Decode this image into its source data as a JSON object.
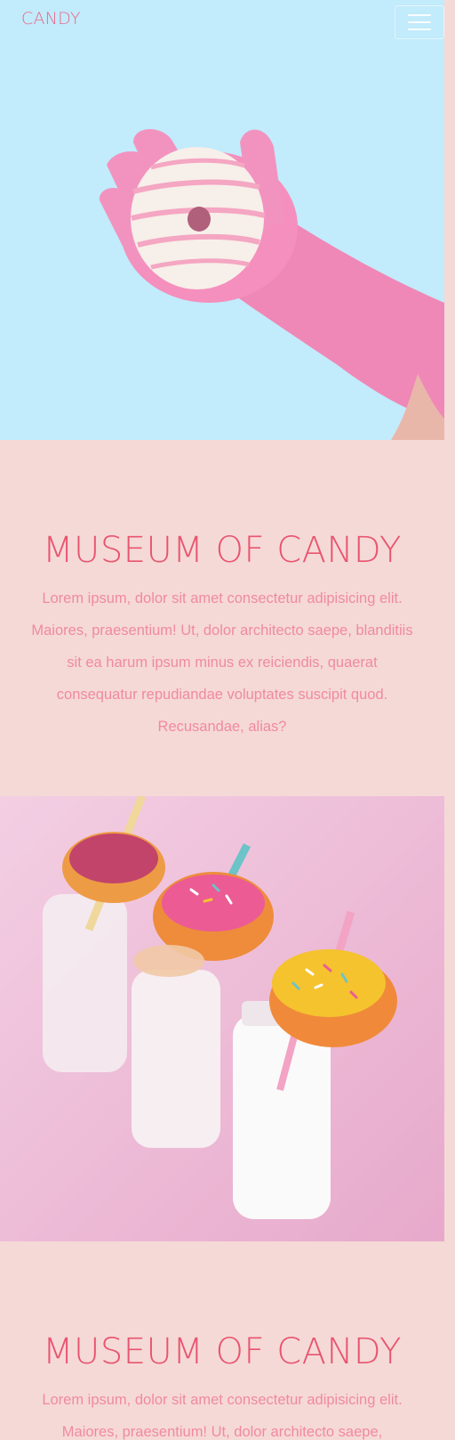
{
  "navbar": {
    "brand": "CANDY",
    "toggler_icon": "hamburger-menu-icon"
  },
  "hero_images": [
    {
      "name": "hero-image-donut-glove",
      "description_icon": "photo-icon"
    },
    {
      "name": "hero-image-donut-milk-bottles",
      "description_icon": "photo-icon"
    }
  ],
  "sections": [
    {
      "title": "MUSEUM OF CANDY",
      "body": "Lorem ipsum, dolor sit amet consectetur adipisicing elit. Maiores, praesentium! Ut, dolor architecto saepe, blanditiis sit ea harum ipsum minus ex reiciendis, quaerat consequatur repudiandae voluptates suscipit quod. Recusandae, alias?"
    },
    {
      "title": "MUSEUM OF CANDY",
      "body": "Lorem ipsum, dolor sit amet consectetur adipisicing elit. Maiores, praesentium! Ut, dolor architecto saepe,"
    }
  ],
  "colors": {
    "page_bg": "#f5d9d7",
    "brand": "#e86b8a",
    "title": "#e8556f",
    "body_text": "#f08aa0",
    "hero1_bg": "#c2ebfb",
    "hero2_bg": "#ecbcd6"
  }
}
